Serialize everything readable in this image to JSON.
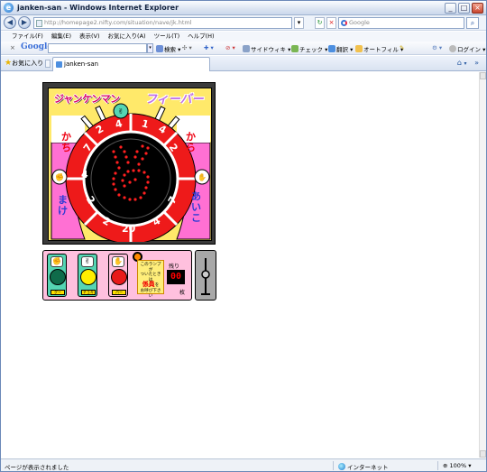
{
  "window": {
    "title": "janken-san - Windows Internet Explorer"
  },
  "nav": {
    "url": "http://homepage2.nifty.com/situation/nave/jk.html",
    "search_placeholder": "Google"
  },
  "menu": [
    "ファイル(F)",
    "編集(E)",
    "表示(V)",
    "お気に入り(A)",
    "ツール(T)",
    "ヘルプ(H)"
  ],
  "google_toolbar": {
    "logo": "Google",
    "search": "検索",
    "sidewiki": "サイドウィキ",
    "check": "チェック",
    "translate": "翻訳",
    "autofill": "オートフィル",
    "login": "ログイン"
  },
  "tabs": {
    "favorites": "お気に入り",
    "active_tab": "janken-san"
  },
  "game": {
    "title_left": "ジャンケンマン",
    "title_right": "フィーバー",
    "left_top": "かち",
    "right_top": "から",
    "left_bottom": "まけ",
    "right_bottom": "あいこ",
    "wheel_numbers": [
      "2",
      "4",
      "7",
      "1",
      "4",
      "2",
      "4",
      "2",
      "20",
      "2",
      "4",
      "7"
    ],
    "lamp_tags": [
      "グー",
      "チョキ",
      "パー"
    ],
    "lamp_colors": [
      "#0f6b4a",
      "#ffee00",
      "#e81a1a"
    ],
    "notice_line1": "このランプが",
    "notice_line2": "ついたときは",
    "notice_staff": "係員",
    "notice_line3": "を",
    "notice_line4": "お呼び下さい",
    "remaining_label": "残り",
    "remaining_value": "00",
    "unit": "枚"
  },
  "status": {
    "text": "ページが表示されました",
    "zone": "インターネット",
    "zoom": "100%"
  }
}
